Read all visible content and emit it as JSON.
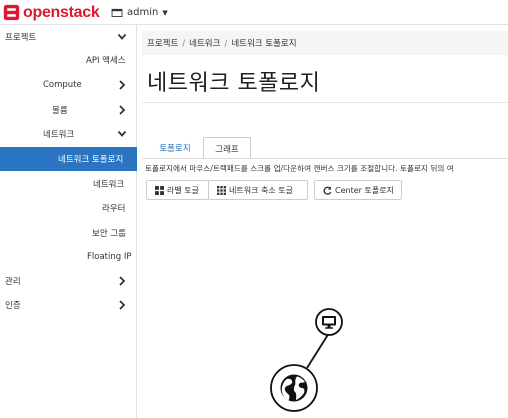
{
  "app": {
    "logo_text": "openstack",
    "project_selector": "admin",
    "brand_color": "#da1a32"
  },
  "sidebar": {
    "items": [
      {
        "label": "프로젝트",
        "expanded": true
      },
      {
        "label": "API 액세스"
      },
      {
        "label": "Compute"
      },
      {
        "label": "볼륨"
      },
      {
        "label": "네트워크",
        "expanded": true
      },
      {
        "label": "네트워크 토폴로지",
        "active": true
      },
      {
        "label": "네트워크"
      },
      {
        "label": "라우터"
      },
      {
        "label": "보안 그룹"
      },
      {
        "label": "Floating IP"
      },
      {
        "label": "관리"
      },
      {
        "label": "인증"
      }
    ],
    "active_color": "#2a74c2"
  },
  "breadcrumb": [
    "프로젝트",
    "네트워크",
    "네트워크 토폴로지"
  ],
  "page_title": "네트워크 토폴로지",
  "tabs": [
    {
      "label": "토폴로지",
      "active": false
    },
    {
      "label": "그래프",
      "active": true
    }
  ],
  "help_text": "토폴로지에서 마우스/트랙패드를 스크롤 업/다운하여 캔버스 크기를 조절합니다. 토폴로지 뒤의 여",
  "toolbar": {
    "label_toggle": "라벨 토글",
    "collapse_toggle": "네트워크 축소 토글",
    "center_topology": "Center 토폴로지"
  },
  "topology_nodes": [
    {
      "type": "external-network",
      "icon": "globe-icon"
    },
    {
      "type": "instance",
      "icon": "monitor-icon"
    }
  ]
}
